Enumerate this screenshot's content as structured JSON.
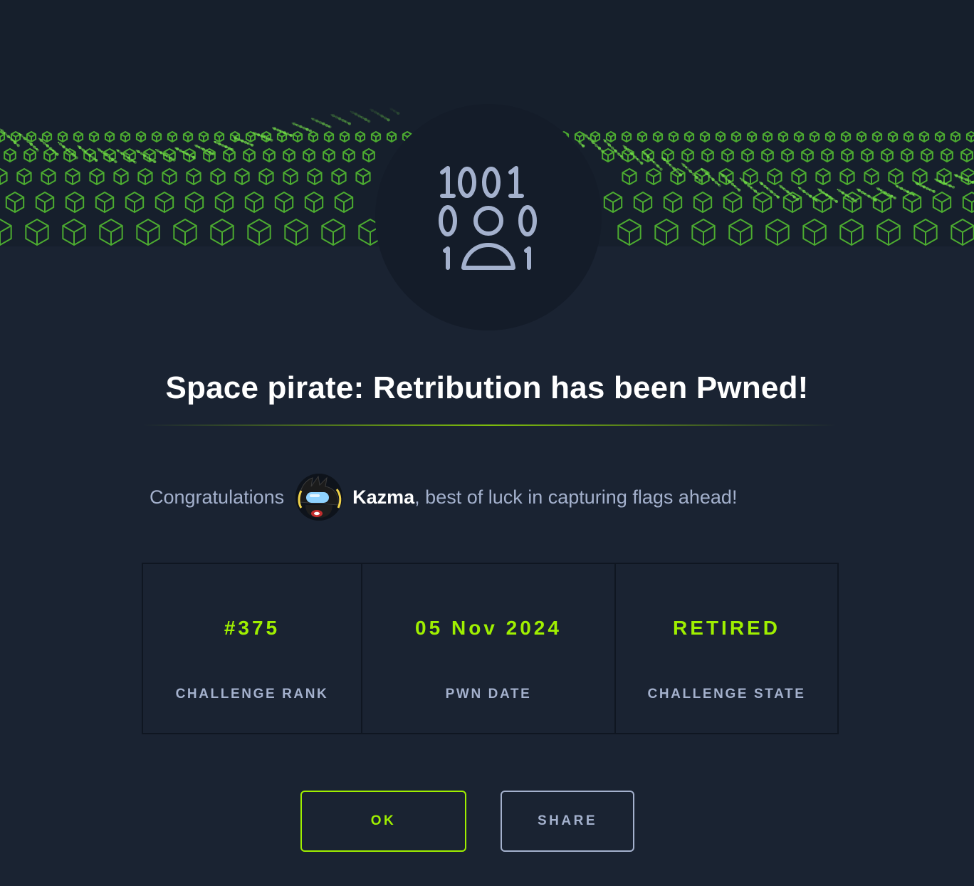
{
  "modal": {
    "title": "Space pirate: Retribution has been Pwned!",
    "congrats_prefix": "Congratulations",
    "username": "Kazma",
    "congrats_suffix": ", best of luck in capturing flags ahead!",
    "emblem_icon": "binary-user-icon",
    "accent_color": "#9fef00",
    "background_color": "#1a2332"
  },
  "stats": [
    {
      "value": "#375",
      "label": "CHALLENGE RANK"
    },
    {
      "value": "05 Nov 2024",
      "label": "PWN DATE"
    },
    {
      "value": "RETIRED",
      "label": "CHALLENGE STATE"
    }
  ],
  "buttons": {
    "ok_label": "OK",
    "share_label": "SHARE"
  }
}
